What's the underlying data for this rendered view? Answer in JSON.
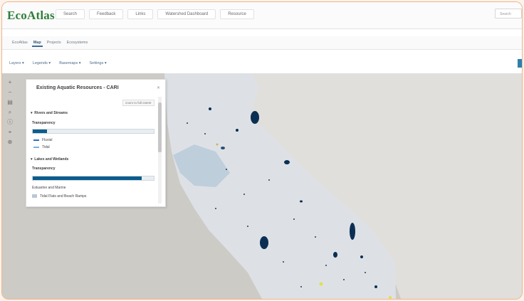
{
  "app": {
    "title": "EcoAtlas"
  },
  "nav": {
    "items": [
      "Search",
      "Feedback",
      "Links",
      "Watershed Dashboard",
      "Resource"
    ]
  },
  "search": {
    "placeholder": "Search"
  },
  "breadcrumbs": [
    "EcoAtlas",
    "Map",
    "Projects",
    "Ecosystems"
  ],
  "toolbar": {
    "items": [
      "Layers ▾",
      "Legends ▾",
      "Basemaps ▾",
      "Settings ▾"
    ]
  },
  "panel": {
    "title": "Existing Aquatic Resources - CARI",
    "zoom_link": "zoom to full extent",
    "section1": {
      "label": "Rivers and Streams"
    },
    "transparency_label": "Transparency",
    "transparency_1": 0.12,
    "legend_items": [
      "Fluvial",
      "Tidal"
    ],
    "section2": {
      "label": "Lakes and Wetlands"
    },
    "transparency_2": 0.9,
    "subgroup": "Estuarine and Marine",
    "last_item": "Tidal Flats and Beach Ramps"
  },
  "colors": {
    "accent": "#2e7fb0",
    "logo": "#2f7d3a",
    "map_land": "#dcdde0",
    "map_water": "#0b2f52"
  }
}
